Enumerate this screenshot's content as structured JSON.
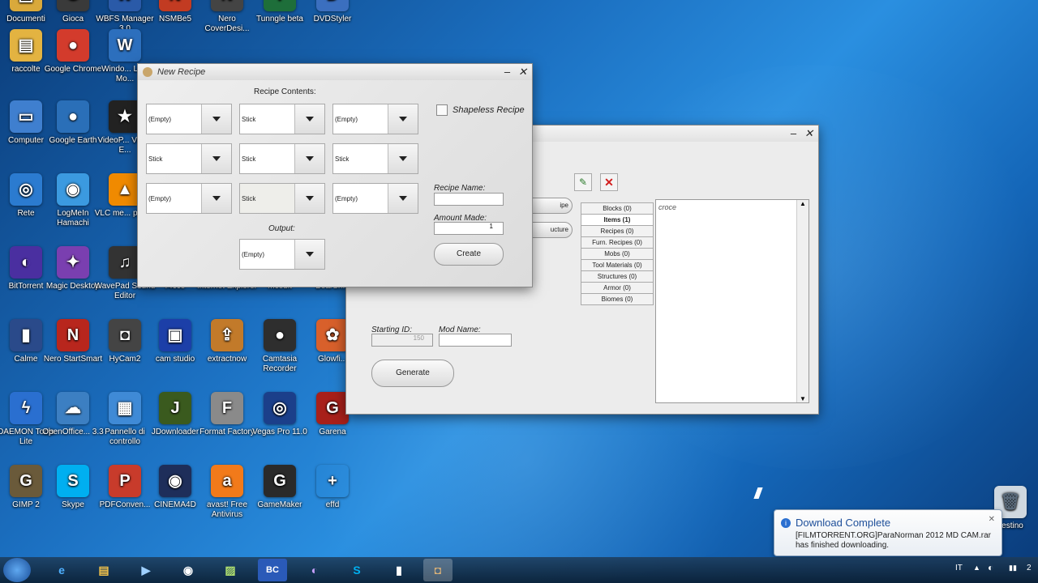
{
  "desktop_icons": [
    {
      "label": "Documenti",
      "glyph": "▤",
      "color": "#d9a93b"
    },
    {
      "label": "Gioca",
      "glyph": "G",
      "color": "#3a3a3a"
    },
    {
      "label": "WBFS Manager 3.0",
      "glyph": "W",
      "color": "#2a5aa8"
    },
    {
      "label": "NSMBe5",
      "glyph": "N",
      "color": "#c23b22"
    },
    {
      "label": "Nero CoverDesi...",
      "glyph": "N",
      "color": "#444"
    },
    {
      "label": "Tunngle beta",
      "glyph": "T",
      "color": "#1e6e3a"
    },
    {
      "label": "DVDStyler",
      "glyph": "D",
      "color": "#3b6fbf"
    },
    {
      "label": "raccolte",
      "glyph": "▤",
      "color": "#e3b341"
    },
    {
      "label": "Google Chrome",
      "glyph": "●",
      "color": "#d33b2c"
    },
    {
      "label": "Windo... Live Mo...",
      "glyph": "W",
      "color": "#2c6fbd"
    },
    {
      "label": "Computer",
      "glyph": "▭",
      "color": "#3f7fcf"
    },
    {
      "label": "Google Earth",
      "glyph": "●",
      "color": "#2a6fb8"
    },
    {
      "label": "VideoP... Video E...",
      "glyph": "★",
      "color": "#222"
    },
    {
      "label": "Rete",
      "glyph": "◎",
      "color": "#2b7bd0"
    },
    {
      "label": "LogMeIn Hamachi",
      "glyph": "◉",
      "color": "#3b9ae0"
    },
    {
      "label": "VLC me... player",
      "glyph": "▲",
      "color": "#f08a00"
    },
    {
      "label": "BitTorrent",
      "glyph": "◐",
      "color": "#4a2fa0"
    },
    {
      "label": "Magic Desktop",
      "glyph": "✦",
      "color": "#7a3fb0"
    },
    {
      "label": "WavePad Sound Editor",
      "glyph": "♫",
      "color": "#333"
    },
    {
      "label": "Calme",
      "glyph": "▮",
      "color": "#2a4a8a"
    },
    {
      "label": "Nero StartSmart",
      "glyph": "N",
      "color": "#b8261d"
    },
    {
      "label": "HyCam2",
      "glyph": "◘",
      "color": "#444"
    },
    {
      "label": "cam studio",
      "glyph": "▣",
      "color": "#1c3fa8"
    },
    {
      "label": "extractnow",
      "glyph": "⇪",
      "color": "#c27a2a"
    },
    {
      "label": "Camtasia Recorder",
      "glyph": "●",
      "color": "#2e2e2e"
    },
    {
      "label": "Glowfi...",
      "glyph": "✿",
      "color": "#d8602b"
    },
    {
      "label": "DAEMON Tools Lite",
      "glyph": "ϟ",
      "color": "#2a6fd0"
    },
    {
      "label": "OpenOffice... 3.3",
      "glyph": "☁",
      "color": "#3c7fc2"
    },
    {
      "label": "Pannello di controllo",
      "glyph": "▦",
      "color": "#3f8ad6"
    },
    {
      "label": "JDownloader",
      "glyph": "J",
      "color": "#3a5a1e"
    },
    {
      "label": "Format Factory",
      "glyph": "F",
      "color": "#8a8a8a"
    },
    {
      "label": "Vegas Pro 11.0",
      "glyph": "◎",
      "color": "#1b3f8a"
    },
    {
      "label": "Garena",
      "glyph": "G",
      "color": "#a8201a"
    },
    {
      "label": "GIMP 2",
      "glyph": "G",
      "color": "#6a5a3a"
    },
    {
      "label": "Skype",
      "glyph": "S",
      "color": "#00aff0"
    },
    {
      "label": "PDFConven...",
      "glyph": "P",
      "color": "#c83b2b"
    },
    {
      "label": "CINEMA4D",
      "glyph": "◉",
      "color": "#1e2e5a"
    },
    {
      "label": "avast! Free Antivirus",
      "glyph": "a",
      "color": "#f27a1a"
    },
    {
      "label": "GameMaker",
      "glyph": "G",
      "color": "#2a2a2a"
    },
    {
      "label": "effd",
      "glyph": "+",
      "color": "transparent"
    },
    {
      "label": "mcedit",
      "glyph": "▩",
      "color": "#555"
    },
    {
      "label": "r4cce",
      "glyph": "r",
      "color": "#3a6aa0"
    },
    {
      "label": "Internet Explorer",
      "glyph": "e",
      "color": "#1f7fd0"
    },
    {
      "label": "BearSh...",
      "glyph": "B",
      "color": "#c43b2b"
    }
  ],
  "new_recipe": {
    "title": "New Recipe",
    "contents_label": "Recipe Contents:",
    "grid": [
      "(Empty)",
      "Stick",
      "(Empty)",
      "Stick",
      "Stick",
      "Stick",
      "(Empty)",
      "Stick",
      "(Empty)"
    ],
    "output_label": "Output:",
    "output_value": "(Empty)",
    "shapeless_label": "Shapeless Recipe",
    "recipe_name_label": "Recipe Name:",
    "recipe_name_value": "",
    "amount_label": "Amount Made:",
    "amount_value": "1",
    "create_button": "Create"
  },
  "mod_window": {
    "tabs": [
      "Blocks (0)",
      "Items (1)",
      "Recipes (0)",
      "Furn. Recipes (0)",
      "Mobs (0)",
      "Tool Materials (0)",
      "Structures (0)",
      "Armor (0)",
      "Biomes (0)"
    ],
    "list_items": [
      "croce"
    ],
    "partial_button_1": "ipe",
    "partial_button_2": "ucture",
    "starting_id_label": "Starting ID:",
    "starting_id_value": "150",
    "mod_name_label": "Mod Name:",
    "mod_name_value": "",
    "generate_button": "Generate"
  },
  "notification": {
    "title": "Download Complete",
    "body": "[FILMTORRENT.ORG]ParaNorman 2012 MD CAM.rar has finished downloading."
  },
  "taskbar": {
    "lang": "IT",
    "recycle_label": "cestino",
    "clock_partial": "2"
  }
}
